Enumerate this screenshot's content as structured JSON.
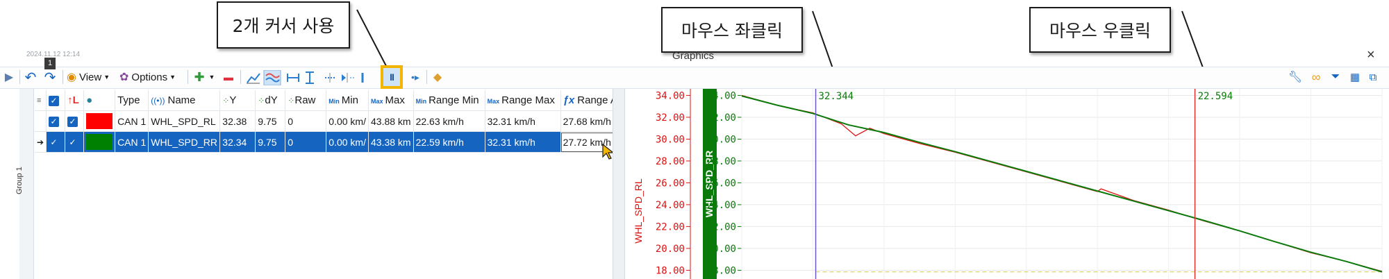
{
  "callouts": {
    "cursor_mode": "2개 커서 사용",
    "left_click": "마우스 좌클릭",
    "right_click": "마우스 우클릭"
  },
  "window": {
    "timestamp": "2024.11.12 12:14",
    "title": "Graphics",
    "close": "×"
  },
  "toolbar": {
    "play": "▶",
    "undo": "↶",
    "redo": "↷",
    "redo_badge": "1",
    "view_label": "View",
    "options_label": "Options",
    "add": "✚",
    "remove": "▬",
    "pause": "II"
  },
  "signal_table": {
    "group_label": "Group 1",
    "headers": {
      "type": "Type",
      "name": "Name",
      "y": "Y",
      "dy": "dY",
      "raw": "Raw",
      "min": "Min",
      "max": "Max",
      "range_min": "Range Min",
      "range_max": "Range Max",
      "range_avg": "Range Avg"
    },
    "badges": {
      "min": "Min",
      "max": "Max",
      "fx": "ƒx"
    },
    "rows": [
      {
        "type": "CAN 1",
        "name": "WHL_SPD_RL",
        "y": "32.38",
        "dy": "9.75",
        "raw": "0",
        "min": "0.00 km/",
        "max": "43.88 km",
        "range_min": "22.63 km/h",
        "range_max": "32.31 km/h",
        "range_avg": "27.68 km/h",
        "color": "#ff0000"
      },
      {
        "type": "CAN 1",
        "name": "WHL_SPD_RR",
        "y": "32.34",
        "dy": "9.75",
        "raw": "0",
        "min": "0.00 km/",
        "max": "43.38 km",
        "range_min": "22.59 km/h",
        "range_max": "32.31 km/h",
        "range_avg": "27.72 km/h",
        "color": "#008000"
      }
    ]
  },
  "chart_data": {
    "type": "line",
    "series": [
      {
        "name": "WHL_SPD_RL",
        "color": "#e01010",
        "x": [
          0,
          50,
          100,
          140,
          160,
          180,
          200,
          250,
          300,
          350,
          400,
          450,
          500,
          505,
          550,
          600,
          650,
          700,
          750,
          800,
          850,
          900
        ],
        "y": [
          34.0,
          33.1,
          32.4,
          31.4,
          30.3,
          31.0,
          30.5,
          29.6,
          28.8,
          27.9,
          27.0,
          26.1,
          25.2,
          25.45,
          24.4,
          23.5,
          22.5,
          21.6,
          20.6,
          19.6,
          18.8,
          17.9
        ]
      },
      {
        "name": "WHL_SPD_RR",
        "color": "#0a7a0a",
        "x": [
          0,
          50,
          100,
          150,
          200,
          250,
          300,
          350,
          400,
          450,
          500,
          550,
          600,
          650,
          700,
          750,
          800,
          850,
          900
        ],
        "y": [
          33.95,
          33.1,
          32.35,
          31.3,
          30.6,
          29.7,
          28.85,
          27.95,
          27.05,
          26.15,
          25.25,
          24.35,
          23.45,
          22.55,
          21.6,
          20.6,
          19.65,
          18.8,
          17.85
        ]
      }
    ],
    "cursors": [
      {
        "label": "32.344",
        "color": "#6a5acd",
        "x": 104
      },
      {
        "label": "22.594",
        "color": "#e03030",
        "x": 637
      }
    ],
    "y_axis_rl": {
      "label": "WHL_SPD_RL",
      "ticks": [
        "34.00",
        "32.00",
        "30.00",
        "28.00",
        "26.00",
        "24.00",
        "22.00",
        "20.00",
        "18.00"
      ],
      "color": "#e01010"
    },
    "y_axis_rr": {
      "label": "WHL_SPD_RR",
      "ticks": [
        "34.00",
        "32.00",
        "30.00",
        "28.00",
        "26.00",
        "24.00",
        "22.00",
        "20.00",
        "18.00"
      ],
      "color": "#0a7a0a"
    },
    "ylim": [
      17.2,
      34.6
    ],
    "xlim": [
      0,
      900
    ],
    "grid": true,
    "reference_line": 17.85
  }
}
